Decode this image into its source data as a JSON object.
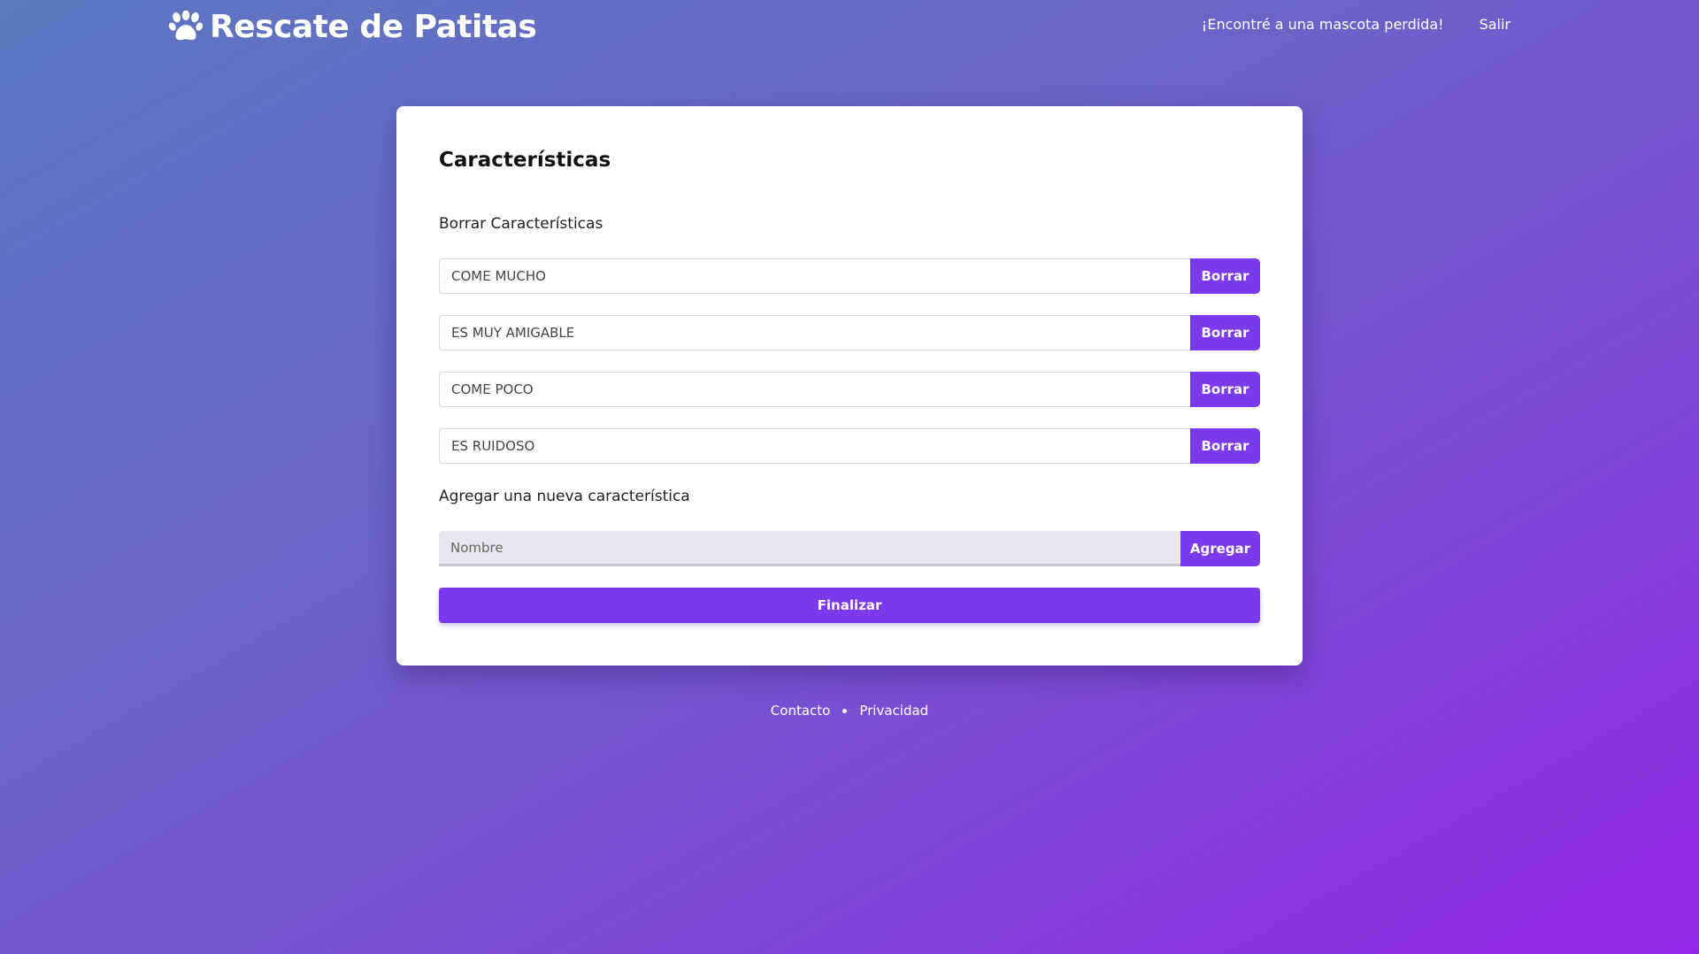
{
  "header": {
    "brand": "Rescate de Patitas",
    "brand_icon": "paw-icon",
    "nav": [
      {
        "label": "¡Encontré a una mascota perdida!"
      },
      {
        "label": "Salir"
      }
    ]
  },
  "card": {
    "title": "Características",
    "delete_section_label": "Borrar Características",
    "characteristics": [
      {
        "value": "COME MUCHO",
        "button": "Borrar"
      },
      {
        "value": "ES MUY AMIGABLE",
        "button": "Borrar"
      },
      {
        "value": "COME POCO",
        "button": "Borrar"
      },
      {
        "value": "ES RUIDOSO",
        "button": "Borrar"
      }
    ],
    "add_section_label": "Agregar una nueva característica",
    "new_characteristic": {
      "placeholder": "Nombre",
      "value": "",
      "button": "Agregar"
    },
    "finish_button": "Finalizar"
  },
  "footer": {
    "links": [
      "Contacto",
      "Privacidad"
    ]
  },
  "colors": {
    "accent": "#7c3aed",
    "background_start": "#5b78c0",
    "background_end": "#9427e6"
  }
}
